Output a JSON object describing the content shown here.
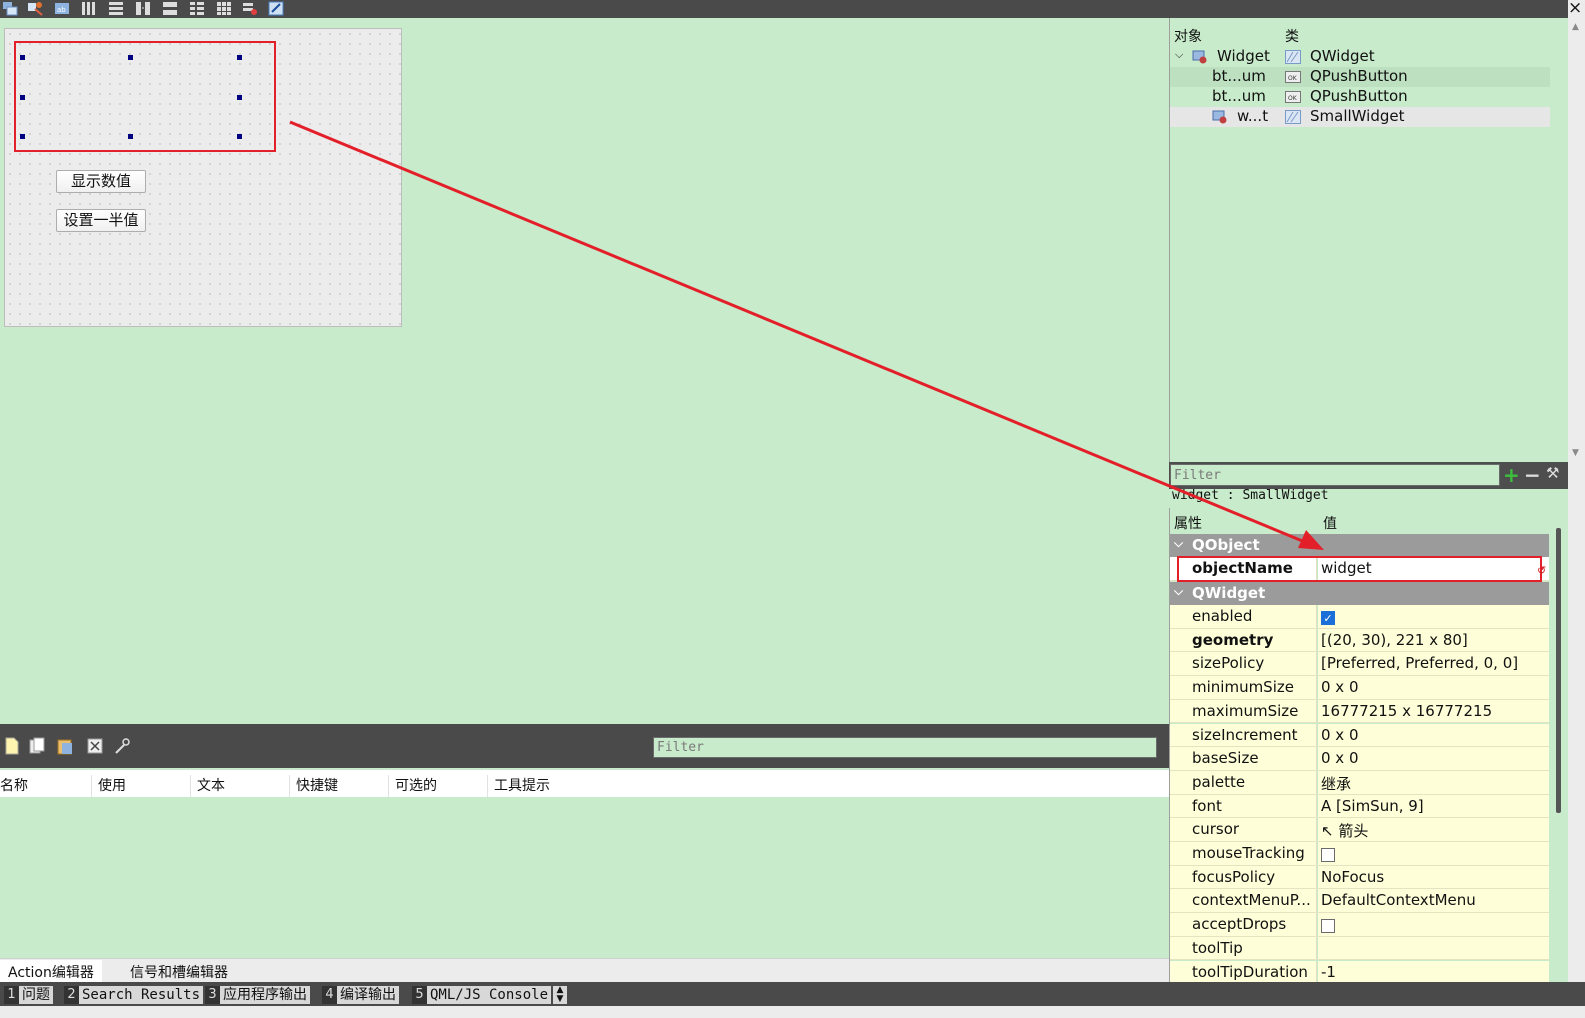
{
  "toolbar": {
    "icons": [
      "edit-widgets-icon",
      "edit-signals-icon",
      "edit-buddies-icon",
      "edit-tab-order-icon",
      "layout-horizontal-icon",
      "layout-vertical-icon",
      "layout-h-splitter-icon",
      "layout-v-splitter-icon",
      "layout-form-icon",
      "layout-grid-icon",
      "break-layout-icon",
      "adjust-size-icon"
    ],
    "close": "×"
  },
  "form": {
    "button1": "显示数值",
    "button2": "设置一半值"
  },
  "object_inspector": {
    "col_object": "对象",
    "col_class": "类",
    "rows": [
      {
        "name": "Widget",
        "class": "QWidget",
        "icon": "widget-icon",
        "class_icon": "qwidget-class-icon"
      },
      {
        "name": "bt...um",
        "class": "QPushButton",
        "icon": "",
        "class_icon": "pushbutton-class-icon"
      },
      {
        "name": "bt...um",
        "class": "QPushButton",
        "icon": "",
        "class_icon": "pushbutton-class-icon"
      },
      {
        "name": "w...t",
        "class": "SmallWidget",
        "icon": "widget-icon",
        "class_icon": "qwidget-class-icon"
      }
    ],
    "filter_placeholder": "Filter",
    "selected": "widget : SmallWidget"
  },
  "property_editor": {
    "col_property": "属性",
    "col_value": "值",
    "groups": {
      "qobject": "QObject",
      "qwidget": "QWidget"
    },
    "objectName": {
      "name": "objectName",
      "value": "widget"
    },
    "props": [
      {
        "name": "enabled",
        "value": "",
        "checkbox": true,
        "checked": true,
        "expand": false,
        "bold": false
      },
      {
        "name": "geometry",
        "value": "[(20, 30), 221 x 80]",
        "expand": true,
        "bold": true
      },
      {
        "name": "sizePolicy",
        "value": "[Preferred, Preferred, 0, 0]",
        "expand": true,
        "bold": false
      },
      {
        "name": "minimumSize",
        "value": "0 x 0",
        "expand": true,
        "bold": false
      },
      {
        "name": "maximumSize",
        "value": "16777215 x 16777215",
        "expand": true,
        "bold": false
      },
      {
        "name": "sizeIncrement",
        "value": "0 x 0",
        "expand": true,
        "bold": false
      },
      {
        "name": "baseSize",
        "value": "0 x 0",
        "expand": true,
        "bold": false
      },
      {
        "name": "palette",
        "value": "继承",
        "expand": false,
        "bold": false
      },
      {
        "name": "font",
        "value": "A  [SimSun, 9]",
        "expand": true,
        "bold": false
      },
      {
        "name": "cursor",
        "value": "↖  箭头",
        "expand": false,
        "bold": false
      },
      {
        "name": "mouseTracking",
        "value": "",
        "checkbox": true,
        "checked": false,
        "expand": false,
        "bold": false
      },
      {
        "name": "focusPolicy",
        "value": "NoFocus",
        "expand": false,
        "bold": false
      },
      {
        "name": "contextMenuP...",
        "value": "DefaultContextMenu",
        "expand": false,
        "bold": false
      },
      {
        "name": "acceptDrops",
        "value": "",
        "checkbox": true,
        "checked": false,
        "expand": false,
        "bold": false
      },
      {
        "name": "toolTip",
        "value": "",
        "expand": true,
        "bold": false
      },
      {
        "name": "toolTipDuration",
        "value": "-1",
        "expand": false,
        "bold": false
      }
    ]
  },
  "action_editor": {
    "filter_placeholder": "Filter",
    "columns": [
      "名称",
      "使用",
      "文本",
      "快捷键",
      "可选的",
      "工具提示"
    ],
    "tabs": [
      "Action编辑器",
      "信号和槽编辑器"
    ]
  },
  "statusbar": {
    "items": [
      {
        "num": "1",
        "label": "问题"
      },
      {
        "num": "2",
        "label": "Search Results"
      },
      {
        "num": "3",
        "label": "应用程序输出"
      },
      {
        "num": "4",
        "label": "编译输出"
      },
      {
        "num": "5",
        "label": "QML/JS Console"
      }
    ]
  },
  "colors": {
    "background": "#c8ebcb",
    "annotation_red": "#e3202a",
    "selection_handle": "#000080",
    "property_value_bg": "#fefed8",
    "group_header": "#9b9b9b"
  }
}
